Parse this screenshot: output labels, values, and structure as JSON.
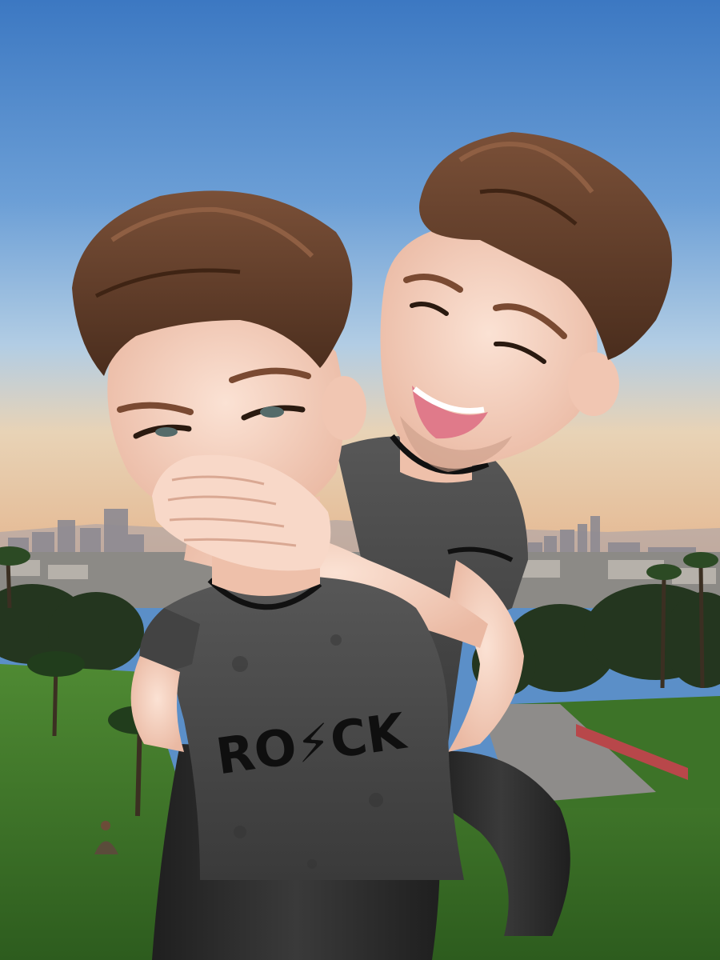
{
  "scene": {
    "description_kind": "photo-composite",
    "shirt_print_text": "RO⚡CK",
    "colors": {
      "sky_top": "#3f7cc4",
      "sky_mid": "#8fb6dc",
      "sky_horizon": "#e9cda8",
      "hill_grass": "#3e7a2a",
      "grass_dark": "#2f5f20",
      "tree_dark": "#24361f",
      "hair": "#5a3826",
      "skin": "#f6d4c4",
      "shirt": "#4b4b4b",
      "pants": "#2a2a2a",
      "bridge": "#b8474a"
    }
  }
}
